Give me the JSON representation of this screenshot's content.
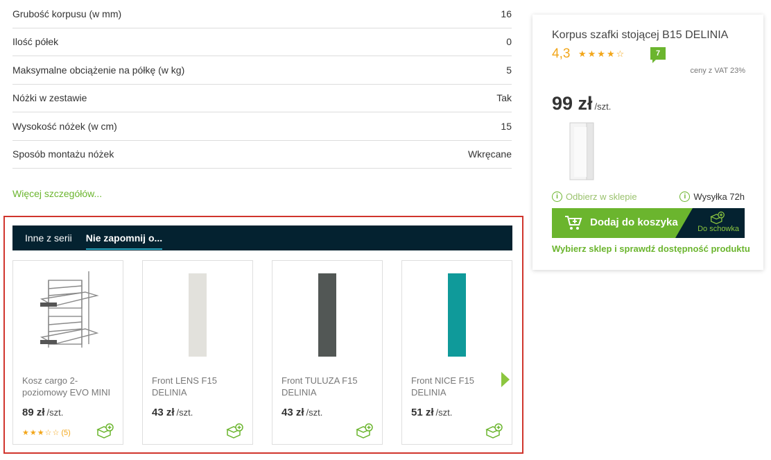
{
  "specs": [
    {
      "label": "Grubość korpusu (w mm)",
      "value": "16"
    },
    {
      "label": "Ilość półek",
      "value": "0"
    },
    {
      "label": "Maksymalne obciążenie na półkę (w kg)",
      "value": "5"
    },
    {
      "label": "Nóżki w zestawie",
      "value": "Tak"
    },
    {
      "label": "Wysokość nóżek (w cm)",
      "value": "15"
    },
    {
      "label": "Sposób montażu nóżek",
      "value": "Wkręcane"
    }
  ],
  "more_link": "Więcej szczegółów...",
  "tabs": [
    {
      "label": "Inne z serii"
    },
    {
      "label": "Nie zapomnij o..."
    }
  ],
  "products": [
    {
      "name": "Kosz cargo 2-poziomowy EVO MINI",
      "price": "89 zł",
      "unit": "/szt.",
      "stars": "★★★☆☆",
      "review_count": "(5)",
      "color": "#b0b0b0"
    },
    {
      "name": "Front LENS F15 DELINIA",
      "price": "43 zł",
      "unit": "/szt.",
      "color": "#e2e1dc"
    },
    {
      "name": "Front TULUZA F15 DELINIA",
      "price": "43 zł",
      "unit": "/szt.",
      "color": "#525755"
    },
    {
      "name": "Front NICE F15 DELINIA",
      "price": "51 zł",
      "unit": "/szt.",
      "color": "#0f9a9a"
    }
  ],
  "product_card": {
    "title": "Korpus szafki stojącej B15 DELINIA",
    "rating": "4,3",
    "stars": "★★★★☆",
    "review_count": "7",
    "vat_note": "ceny z VAT 23%",
    "price": "99 zł",
    "unit": "/szt.",
    "pickup": "Odbierz w sklepie",
    "shipping": "Wysyłka 72h",
    "add_to_cart": "Dodaj do koszyka",
    "stash": "Do schowka",
    "store_link": "Wybierz sklep i sprawdź dostępność produktu",
    "info_glyph": "i"
  },
  "colors": {
    "accent": "#6bb52e",
    "navy": "#042230",
    "star": "#f2a61a",
    "highlight": "#d0342c"
  }
}
